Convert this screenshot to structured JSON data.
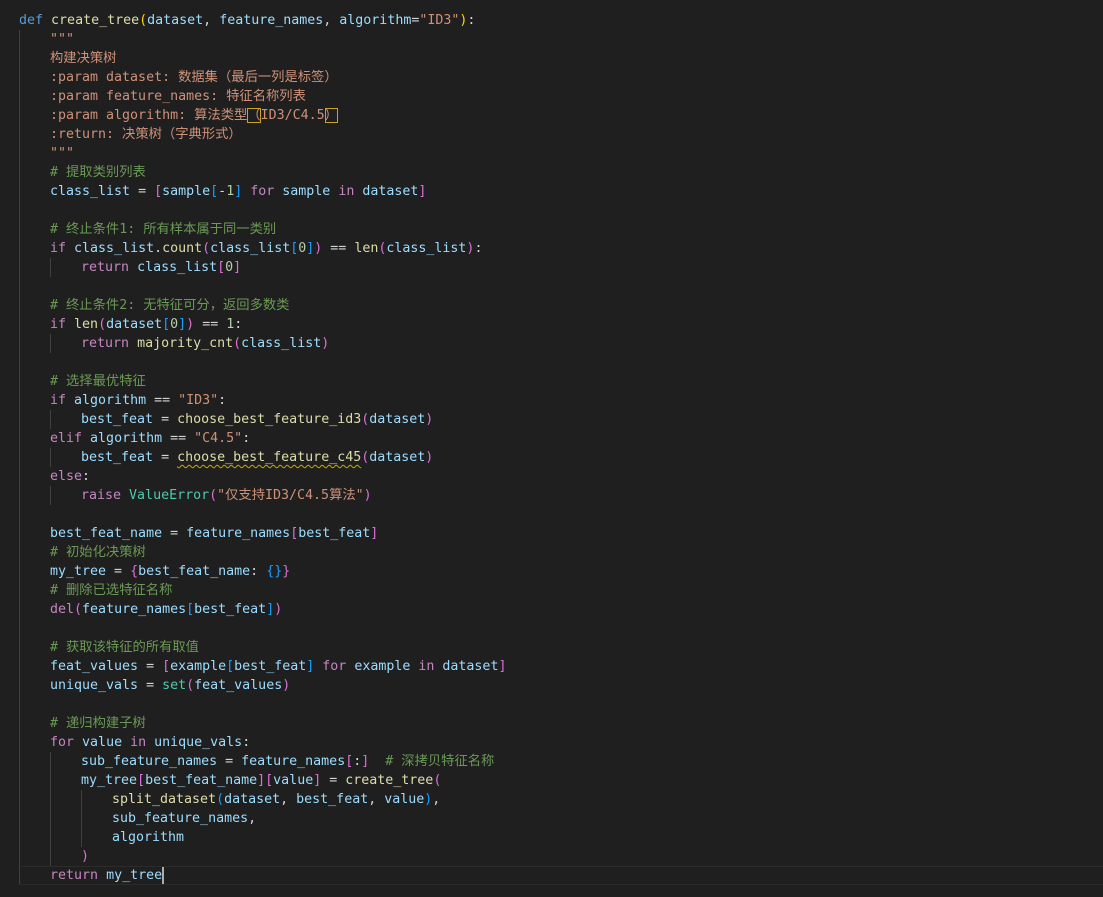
{
  "editor": {
    "language": "python",
    "lines": [
      {
        "indent": 0,
        "tokens": [
          [
            "kw",
            "def"
          ],
          [
            "op",
            " "
          ],
          [
            "fn",
            "create_tree"
          ],
          [
            "b1",
            "("
          ],
          [
            "var",
            "dataset"
          ],
          [
            "op",
            ", "
          ],
          [
            "var",
            "feature_names"
          ],
          [
            "op",
            ", "
          ],
          [
            "var",
            "algorithm"
          ],
          [
            "op",
            "="
          ],
          [
            "str",
            "\"ID3\""
          ],
          [
            "b1",
            ")"
          ],
          [
            "op",
            ":"
          ]
        ]
      },
      {
        "indent": 1,
        "tokens": [
          [
            "doc",
            "\"\"\""
          ]
        ]
      },
      {
        "indent": 1,
        "tokens": [
          [
            "doc",
            "构建决策树"
          ]
        ]
      },
      {
        "indent": 1,
        "tokens": [
          [
            "doc",
            ":param dataset: 数据集（最后一列是标签）"
          ]
        ]
      },
      {
        "indent": 1,
        "tokens": [
          [
            "doc",
            ":param feature_names: 特征名称列表"
          ]
        ]
      },
      {
        "indent": 1,
        "tokens": [
          [
            "doc",
            ":param algorithm: 算法类型"
          ],
          [
            "doc_boxed",
            "（"
          ],
          [
            "doc",
            "ID3/C4.5"
          ],
          [
            "doc_boxed",
            "）"
          ]
        ]
      },
      {
        "indent": 1,
        "tokens": [
          [
            "doc",
            ":return: 决策树（字典形式）"
          ]
        ]
      },
      {
        "indent": 1,
        "tokens": [
          [
            "doc",
            "\"\"\""
          ]
        ]
      },
      {
        "indent": 1,
        "tokens": [
          [
            "cmt",
            "# 提取类别列表"
          ]
        ]
      },
      {
        "indent": 1,
        "tokens": [
          [
            "var",
            "class_list"
          ],
          [
            "op",
            " = "
          ],
          [
            "b2",
            "["
          ],
          [
            "var",
            "sample"
          ],
          [
            "b3",
            "["
          ],
          [
            "op",
            "-"
          ],
          [
            "num",
            "1"
          ],
          [
            "b3",
            "]"
          ],
          [
            "op",
            " "
          ],
          [
            "ctrl",
            "for"
          ],
          [
            "op",
            " "
          ],
          [
            "var",
            "sample"
          ],
          [
            "op",
            " "
          ],
          [
            "ctrl",
            "in"
          ],
          [
            "op",
            " "
          ],
          [
            "var",
            "dataset"
          ],
          [
            "b2",
            "]"
          ]
        ]
      },
      {
        "indent": 0,
        "tokens": []
      },
      {
        "indent": 1,
        "tokens": [
          [
            "cmt",
            "# 终止条件1: 所有样本属于同一类别"
          ]
        ]
      },
      {
        "indent": 1,
        "tokens": [
          [
            "ctrl",
            "if"
          ],
          [
            "op",
            " "
          ],
          [
            "var",
            "class_list"
          ],
          [
            "op",
            "."
          ],
          [
            "fn",
            "count"
          ],
          [
            "b2",
            "("
          ],
          [
            "var",
            "class_list"
          ],
          [
            "b3",
            "["
          ],
          [
            "num",
            "0"
          ],
          [
            "b3",
            "]"
          ],
          [
            "b2",
            ")"
          ],
          [
            "op",
            " == "
          ],
          [
            "fn",
            "len"
          ],
          [
            "b2",
            "("
          ],
          [
            "var",
            "class_list"
          ],
          [
            "b2",
            ")"
          ],
          [
            "op",
            ":"
          ]
        ]
      },
      {
        "indent": 2,
        "tokens": [
          [
            "ctrl",
            "return"
          ],
          [
            "op",
            " "
          ],
          [
            "var",
            "class_list"
          ],
          [
            "b2",
            "["
          ],
          [
            "num",
            "0"
          ],
          [
            "b2",
            "]"
          ]
        ]
      },
      {
        "indent": 0,
        "tokens": []
      },
      {
        "indent": 1,
        "tokens": [
          [
            "cmt",
            "# 终止条件2: 无特征可分，返回多数类"
          ]
        ]
      },
      {
        "indent": 1,
        "tokens": [
          [
            "ctrl",
            "if"
          ],
          [
            "op",
            " "
          ],
          [
            "fn",
            "len"
          ],
          [
            "b2",
            "("
          ],
          [
            "var",
            "dataset"
          ],
          [
            "b3",
            "["
          ],
          [
            "num",
            "0"
          ],
          [
            "b3",
            "]"
          ],
          [
            "b2",
            ")"
          ],
          [
            "op",
            " == "
          ],
          [
            "num",
            "1"
          ],
          [
            "op",
            ":"
          ]
        ]
      },
      {
        "indent": 2,
        "tokens": [
          [
            "ctrl",
            "return"
          ],
          [
            "op",
            " "
          ],
          [
            "fn",
            "majority_cnt"
          ],
          [
            "b2",
            "("
          ],
          [
            "var",
            "class_list"
          ],
          [
            "b2",
            ")"
          ]
        ]
      },
      {
        "indent": 0,
        "tokens": []
      },
      {
        "indent": 1,
        "tokens": [
          [
            "cmt",
            "# 选择最优特征"
          ]
        ]
      },
      {
        "indent": 1,
        "tokens": [
          [
            "ctrl",
            "if"
          ],
          [
            "op",
            " "
          ],
          [
            "var",
            "algorithm"
          ],
          [
            "op",
            " == "
          ],
          [
            "str",
            "\"ID3\""
          ],
          [
            "op",
            ":"
          ]
        ]
      },
      {
        "indent": 2,
        "tokens": [
          [
            "var",
            "best_feat"
          ],
          [
            "op",
            " = "
          ],
          [
            "fn",
            "choose_best_feature_id3"
          ],
          [
            "b2",
            "("
          ],
          [
            "var",
            "dataset"
          ],
          [
            "b2",
            ")"
          ]
        ]
      },
      {
        "indent": 1,
        "tokens": [
          [
            "ctrl",
            "elif"
          ],
          [
            "op",
            " "
          ],
          [
            "var",
            "algorithm"
          ],
          [
            "op",
            " == "
          ],
          [
            "str",
            "\"C4.5\""
          ],
          [
            "op",
            ":"
          ]
        ]
      },
      {
        "indent": 2,
        "tokens": [
          [
            "var",
            "best_feat"
          ],
          [
            "op",
            " = "
          ],
          [
            "fn_squig",
            "choose_best_feature_c45"
          ],
          [
            "b2",
            "("
          ],
          [
            "var",
            "dataset"
          ],
          [
            "b2",
            ")"
          ]
        ]
      },
      {
        "indent": 1,
        "tokens": [
          [
            "ctrl",
            "else"
          ],
          [
            "op",
            ":"
          ]
        ]
      },
      {
        "indent": 2,
        "tokens": [
          [
            "ctrl",
            "raise"
          ],
          [
            "op",
            " "
          ],
          [
            "cls",
            "ValueError"
          ],
          [
            "b2",
            "("
          ],
          [
            "str",
            "\"仅支持ID3/C4.5算法\""
          ],
          [
            "b2",
            ")"
          ]
        ]
      },
      {
        "indent": 0,
        "tokens": []
      },
      {
        "indent": 1,
        "tokens": [
          [
            "var",
            "best_feat_name"
          ],
          [
            "op",
            " = "
          ],
          [
            "var",
            "feature_names"
          ],
          [
            "b2",
            "["
          ],
          [
            "var",
            "best_feat"
          ],
          [
            "b2",
            "]"
          ]
        ]
      },
      {
        "indent": 1,
        "tokens": [
          [
            "cmt",
            "# 初始化决策树"
          ]
        ]
      },
      {
        "indent": 1,
        "tokens": [
          [
            "var",
            "my_tree"
          ],
          [
            "op",
            " = "
          ],
          [
            "b2",
            "{"
          ],
          [
            "var",
            "best_feat_name"
          ],
          [
            "op",
            ": "
          ],
          [
            "b3",
            "{}"
          ],
          [
            "b2",
            "}"
          ]
        ]
      },
      {
        "indent": 1,
        "tokens": [
          [
            "cmt",
            "# 删除已选特征名称"
          ]
        ]
      },
      {
        "indent": 1,
        "tokens": [
          [
            "ctrl",
            "del"
          ],
          [
            "b2",
            "("
          ],
          [
            "var",
            "feature_names"
          ],
          [
            "b3",
            "["
          ],
          [
            "var",
            "best_feat"
          ],
          [
            "b3",
            "]"
          ],
          [
            "b2",
            ")"
          ]
        ]
      },
      {
        "indent": 0,
        "tokens": []
      },
      {
        "indent": 1,
        "tokens": [
          [
            "cmt",
            "# 获取该特征的所有取值"
          ]
        ]
      },
      {
        "indent": 1,
        "tokens": [
          [
            "var",
            "feat_values"
          ],
          [
            "op",
            " = "
          ],
          [
            "b2",
            "["
          ],
          [
            "var",
            "example"
          ],
          [
            "b3",
            "["
          ],
          [
            "var",
            "best_feat"
          ],
          [
            "b3",
            "]"
          ],
          [
            "op",
            " "
          ],
          [
            "ctrl",
            "for"
          ],
          [
            "op",
            " "
          ],
          [
            "var",
            "example"
          ],
          [
            "op",
            " "
          ],
          [
            "ctrl",
            "in"
          ],
          [
            "op",
            " "
          ],
          [
            "var",
            "dataset"
          ],
          [
            "b2",
            "]"
          ]
        ]
      },
      {
        "indent": 1,
        "tokens": [
          [
            "var",
            "unique_vals"
          ],
          [
            "op",
            " = "
          ],
          [
            "cls",
            "set"
          ],
          [
            "b2",
            "("
          ],
          [
            "var",
            "feat_values"
          ],
          [
            "b2",
            ")"
          ]
        ]
      },
      {
        "indent": 0,
        "tokens": []
      },
      {
        "indent": 1,
        "tokens": [
          [
            "cmt",
            "# 递归构建子树"
          ]
        ]
      },
      {
        "indent": 1,
        "tokens": [
          [
            "ctrl",
            "for"
          ],
          [
            "op",
            " "
          ],
          [
            "var",
            "value"
          ],
          [
            "op",
            " "
          ],
          [
            "ctrl",
            "in"
          ],
          [
            "op",
            " "
          ],
          [
            "var",
            "unique_vals"
          ],
          [
            "op",
            ":"
          ]
        ]
      },
      {
        "indent": 2,
        "tokens": [
          [
            "var",
            "sub_feature_names"
          ],
          [
            "op",
            " = "
          ],
          [
            "var",
            "feature_names"
          ],
          [
            "b2",
            "["
          ],
          [
            "op",
            ":"
          ],
          [
            "b2",
            "]"
          ],
          [
            "op",
            "  "
          ],
          [
            "cmt",
            "# 深拷贝特征名称"
          ]
        ]
      },
      {
        "indent": 2,
        "tokens": [
          [
            "var",
            "my_tree"
          ],
          [
            "b2",
            "["
          ],
          [
            "var",
            "best_feat_name"
          ],
          [
            "b2",
            "]"
          ],
          [
            "b2",
            "["
          ],
          [
            "var",
            "value"
          ],
          [
            "b2",
            "]"
          ],
          [
            "op",
            " = "
          ],
          [
            "fn",
            "create_tree"
          ],
          [
            "b2",
            "("
          ]
        ]
      },
      {
        "indent": 3,
        "tokens": [
          [
            "fn",
            "split_dataset"
          ],
          [
            "b3",
            "("
          ],
          [
            "var",
            "dataset"
          ],
          [
            "op",
            ", "
          ],
          [
            "var",
            "best_feat"
          ],
          [
            "op",
            ", "
          ],
          [
            "var",
            "value"
          ],
          [
            "b3",
            ")"
          ],
          [
            "op",
            ","
          ]
        ]
      },
      {
        "indent": 3,
        "tokens": [
          [
            "var",
            "sub_feature_names"
          ],
          [
            "op",
            ","
          ]
        ]
      },
      {
        "indent": 3,
        "tokens": [
          [
            "var",
            "algorithm"
          ]
        ]
      },
      {
        "indent": 2,
        "tokens": [
          [
            "b2",
            ")"
          ]
        ]
      },
      {
        "indent": 1,
        "tokens": [
          [
            "ctrl",
            "return"
          ],
          [
            "op",
            " "
          ],
          [
            "var",
            "my_tree"
          ]
        ]
      }
    ]
  }
}
